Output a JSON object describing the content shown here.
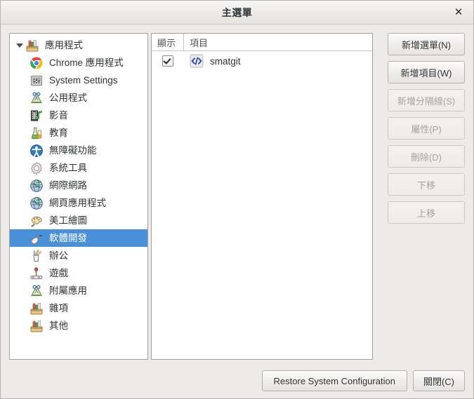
{
  "window": {
    "title": "主選單",
    "close_icon": "close-icon",
    "close_label": "✕"
  },
  "tree": {
    "expander_icon": "chevron-down-icon",
    "root": {
      "label": "應用程式",
      "icon": "applications-crate-icon"
    },
    "items": [
      {
        "label": "Chrome 應用程式",
        "icon": "chrome-icon"
      },
      {
        "label": "System Settings",
        "icon": "system-settings-icon"
      },
      {
        "label": "公用程式",
        "icon": "accessories-icon"
      },
      {
        "label": "影音",
        "icon": "multimedia-icon"
      },
      {
        "label": "教育",
        "icon": "education-icon"
      },
      {
        "label": "無障礙功能",
        "icon": "accessibility-icon"
      },
      {
        "label": "系統工具",
        "icon": "system-tools-gear-icon"
      },
      {
        "label": "網際網路",
        "icon": "internet-globe-icon"
      },
      {
        "label": "網頁應用程式",
        "icon": "web-apps-globe-icon"
      },
      {
        "label": "美工繪圖",
        "icon": "graphics-palette-icon"
      },
      {
        "label": "軟體開發",
        "icon": "development-trowel-icon",
        "selected": true
      },
      {
        "label": "辦公",
        "icon": "office-pencilcup-icon"
      },
      {
        "label": "遊戲",
        "icon": "games-joystick-icon"
      },
      {
        "label": "附屬應用",
        "icon": "accessories-icon"
      },
      {
        "label": "雜項",
        "icon": "other-crate-icon"
      },
      {
        "label": "其他",
        "icon": "other-crate-icon"
      }
    ]
  },
  "list": {
    "columns": {
      "show": "顯示",
      "item": "項目"
    },
    "rows": [
      {
        "checked": true,
        "label": "smatgit",
        "icon": "code-brackets-icon"
      }
    ]
  },
  "side_buttons": [
    {
      "label": "新增選單(N)",
      "enabled": true
    },
    {
      "label": "新增項目(W)",
      "enabled": true
    },
    {
      "label": "新增分隔線(S)",
      "enabled": false
    },
    {
      "label": "屬性(P)",
      "enabled": false
    },
    {
      "label": "刪除(D)",
      "enabled": false
    },
    {
      "label": "下移",
      "enabled": false
    },
    {
      "label": "上移",
      "enabled": false
    }
  ],
  "bottom_buttons": {
    "restore": "Restore System Configuration",
    "close": "關閉(C)"
  },
  "colors": {
    "selection": "#4a90d9",
    "window_bg": "#edebe9",
    "pane_bg": "#ffffff"
  }
}
